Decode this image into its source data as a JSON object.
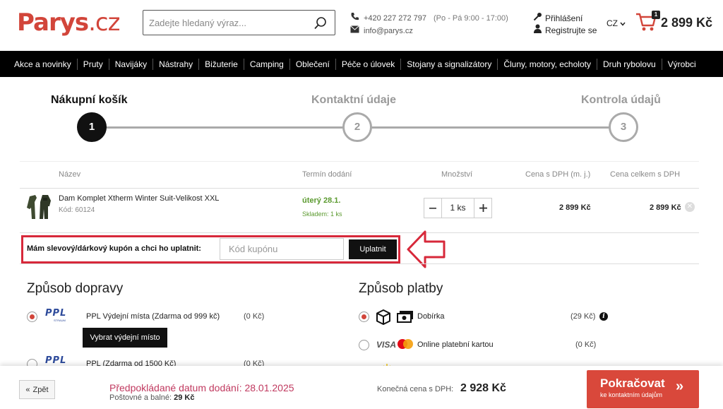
{
  "header": {
    "logo_main": "Parys",
    "logo_tld": ".cz",
    "search_placeholder": "Zadejte hledaný výraz...",
    "phone": "+420 227 272 797",
    "hours": "(Po - Pá 9:00 - 17:00)",
    "email": "info@parys.cz",
    "login": "Přihlášení",
    "register": "Registrujte se",
    "language": "CZ",
    "cart_count": "1",
    "cart_total": "2 899 Kč",
    "brand_color": "#d2453a"
  },
  "nav": [
    "Akce a novinky",
    "Pruty",
    "Navijáky",
    "Nástrahy",
    "Bižuterie",
    "Camping",
    "Oblečení",
    "Péče o úlovek",
    "Stojany a signalizátory",
    "Čluny, motory, echoloty",
    "Druh rybolovu",
    "Výrobci"
  ],
  "steps": [
    {
      "label": "Nákupní košík",
      "number": "1"
    },
    {
      "label": "Kontaktní údaje",
      "number": "2"
    },
    {
      "label": "Kontrola údajů",
      "number": "3"
    }
  ],
  "table": {
    "headers": [
      "Název",
      "Termín dodání",
      "Množství",
      "Cena s DPH (m. j.)",
      "Cena celkem s DPH"
    ],
    "item": {
      "name": "Dam Komplet Xtherm Winter Suit-Velikost XXL",
      "code": "Kód: 60124",
      "delivery": "úterý 28.1.",
      "stock": "Skladem: 1 ks",
      "qty": "1 ks",
      "unit_price": "2 899 Kč",
      "total_price": "2 899 Kč"
    }
  },
  "coupon": {
    "label": "Mám slevový/dárkový kupón a chci ho uplatnit:",
    "placeholder": "Kód kupónu",
    "button": "Uplatnit"
  },
  "shipping": {
    "title": "Způsob dopravy",
    "pick_button": "Vybrat výdejní místo",
    "options": [
      {
        "logo": "PPL",
        "logo_sub": "STRAUM",
        "label": "PPL Výdejní místa (Zdarma od 999 kč)",
        "price": "(0 Kč)"
      },
      {
        "logo": "PPL",
        "label": "PPL (Zdarma od 1500 Kč)",
        "price": "(0 Kč)"
      }
    ]
  },
  "payment": {
    "title": "Způsob platby",
    "options": [
      {
        "label": "Dobírka",
        "price": "(29 Kč)"
      },
      {
        "visa": "VISA",
        "label": "Online platební kartou",
        "price": "(0 Kč)"
      }
    ]
  },
  "footer": {
    "back": "Zpět",
    "est_date": "Předpokládané datum dodání: 28.01.2025",
    "shipping_label": "Poštovné a balné:",
    "shipping_value": "29 Kč",
    "final_label": "Konečná cena s DPH:",
    "final_price": "2 928 Kč",
    "continue": "Pokračovat",
    "continue_sub": "ke kontaktním údajům"
  }
}
